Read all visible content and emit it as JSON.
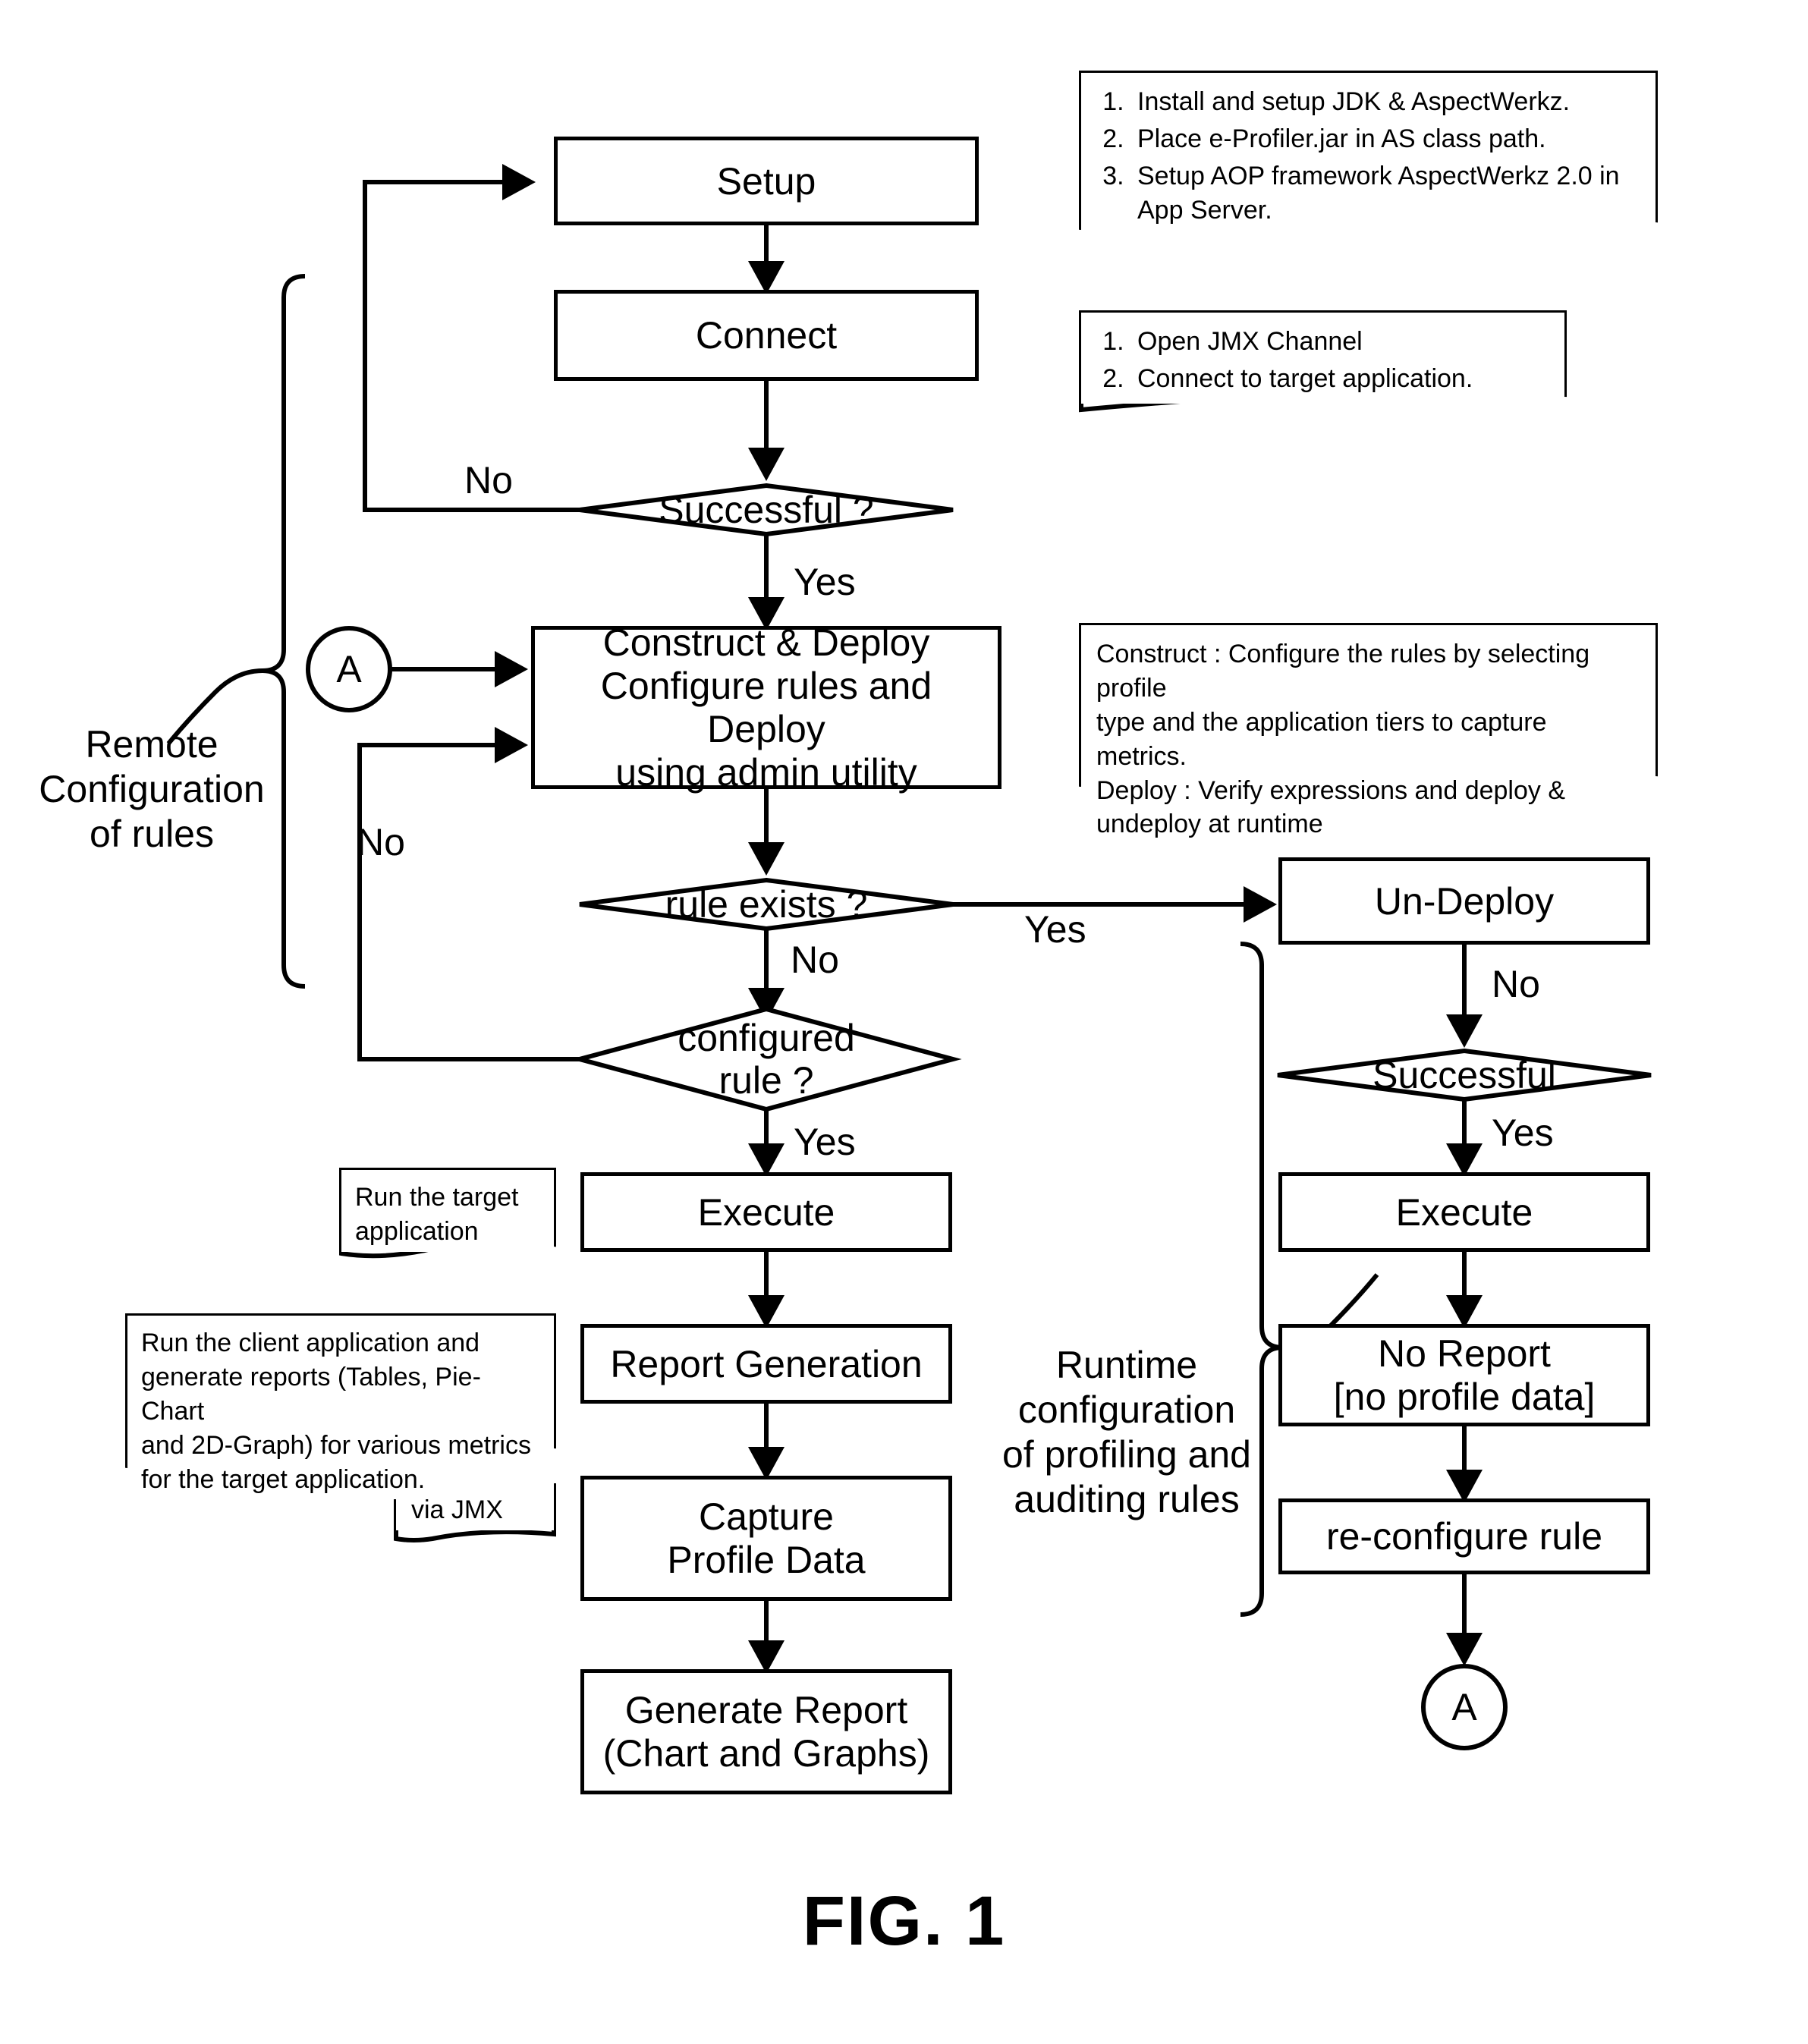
{
  "figure": {
    "caption": "FIG. 1"
  },
  "nodes": {
    "setup": "Setup",
    "connect": "Connect",
    "successful_q": "Successful ?",
    "construct_deploy": "Construct & Deploy\nConfigure rules and Deploy\nusing admin utility",
    "construct_deploy_line1": "Construct & Deploy",
    "construct_deploy_line2": "Configure rules and Deploy",
    "construct_deploy_line3": "using admin utility",
    "rule_exists_q": "rule exists ?",
    "configured_rule_q_line1": "configured",
    "configured_rule_q_line2": "rule ?",
    "execute_left": "Execute",
    "report_generation": "Report Generation",
    "capture_profile_line1": "Capture",
    "capture_profile_line2": "Profile Data",
    "generate_report_line1": "Generate Report",
    "generate_report_line2": "(Chart and Graphs)",
    "un_deploy": "Un-Deploy",
    "successful_right": "Successful",
    "execute_right": "Execute",
    "no_report_line1": "No Report",
    "no_report_line2": "[no profile data]",
    "reconfigure_rule": "re-configure rule",
    "connector_a_left": "A",
    "connector_a_bottom": "A"
  },
  "edge_labels": {
    "successful_no": "No",
    "successful_yes": "Yes",
    "construct_loop_no": "No",
    "rule_exists_yes": "Yes",
    "rule_exists_no": "No",
    "configured_rule_yes": "Yes",
    "undeploy_no": "No",
    "right_successful_yes": "Yes"
  },
  "brace_labels": {
    "remote_config": "Remote\nConfiguration\nof rules",
    "remote_config_line1": "Remote",
    "remote_config_line2": "Configuration",
    "remote_config_line3": "of rules",
    "runtime_config_line1": "Runtime",
    "runtime_config_line2": "configuration",
    "runtime_config_line3": "of profiling and",
    "runtime_config_line4": "auditing rules"
  },
  "notes": {
    "setup_note": {
      "items": [
        "Install and setup JDK & AspectWerkz.",
        "Place e-Profiler.jar in AS class path.",
        "Setup AOP framework AspectWerkz 2.0 in App Server."
      ]
    },
    "connect_note": {
      "items": [
        "Open JMX Channel",
        "Connect to target application."
      ]
    },
    "construct_note": {
      "text_line1": "Construct : Configure the rules by selecting profile",
      "text_line2": "type and the application tiers to capture metrics.",
      "text_line3": "Deploy : Verify expressions and deploy &",
      "text_line4": "undeploy at runtime"
    },
    "run_target_note": {
      "text_line1": "Run the target",
      "text_line2": "application"
    },
    "run_client_note": {
      "text_line1": "Run the client application and",
      "text_line2": "generate reports (Tables, Pie-Chart",
      "text_line3": "and 2D-Graph) for various metrics",
      "text_line4": "for the target application."
    },
    "via_jmx_note": {
      "text": "via JMX"
    }
  },
  "colors": {
    "stroke": "#000000",
    "background": "#ffffff"
  }
}
